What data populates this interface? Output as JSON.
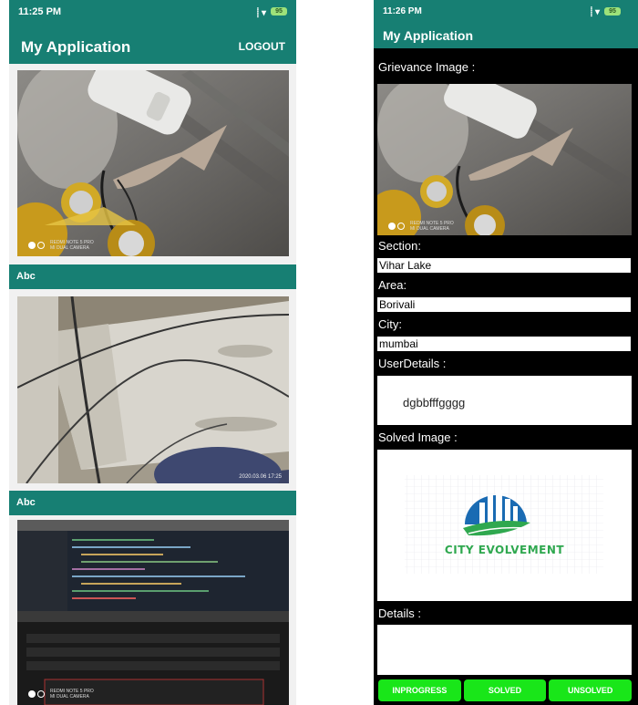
{
  "left": {
    "status_time": "11:25 PM",
    "status_icons": "⸽ ▾",
    "battery": "95",
    "app_title": "My Application",
    "logout_label": "LOGOUT",
    "watermark_1": "REDMI NOTE 5 PRO\nMI DUAL CAMERA",
    "item_labels": [
      "Abc",
      "Abc"
    ],
    "photo_2_timestamp": "2020.03.06 17:25",
    "watermark_3": "REDMI NOTE 5 PRO\nMI DUAL CAMERA"
  },
  "right": {
    "status_time": "11:26 PM",
    "status_icons": "⸽ ▾",
    "battery": "95",
    "app_title": "My Application",
    "grievance_image_label": "Grievance Image :",
    "grievance_watermark": "REDMI NOTE 5 PRO\nMI DUAL CAMERA",
    "section_label": "Section:",
    "section_value": "Vihar Lake",
    "area_label": "Area:",
    "area_value": "Borivali",
    "city_label": "City:",
    "city_value": "mumbai",
    "user_details_label": "UserDetails :",
    "user_details_value": "dgbbfffgggg",
    "solved_image_label": "Solved Image :",
    "logo_text": "CITY EVOLVEMENT",
    "details_label": "Details :",
    "buttons": [
      "INPROGRESS",
      "SOLVED",
      "UNSOLVED"
    ]
  },
  "colors": {
    "teal": "#177f73",
    "green_button": "#19e619",
    "logo_blue": "#1a6bb3",
    "logo_green": "#2fa84f"
  }
}
